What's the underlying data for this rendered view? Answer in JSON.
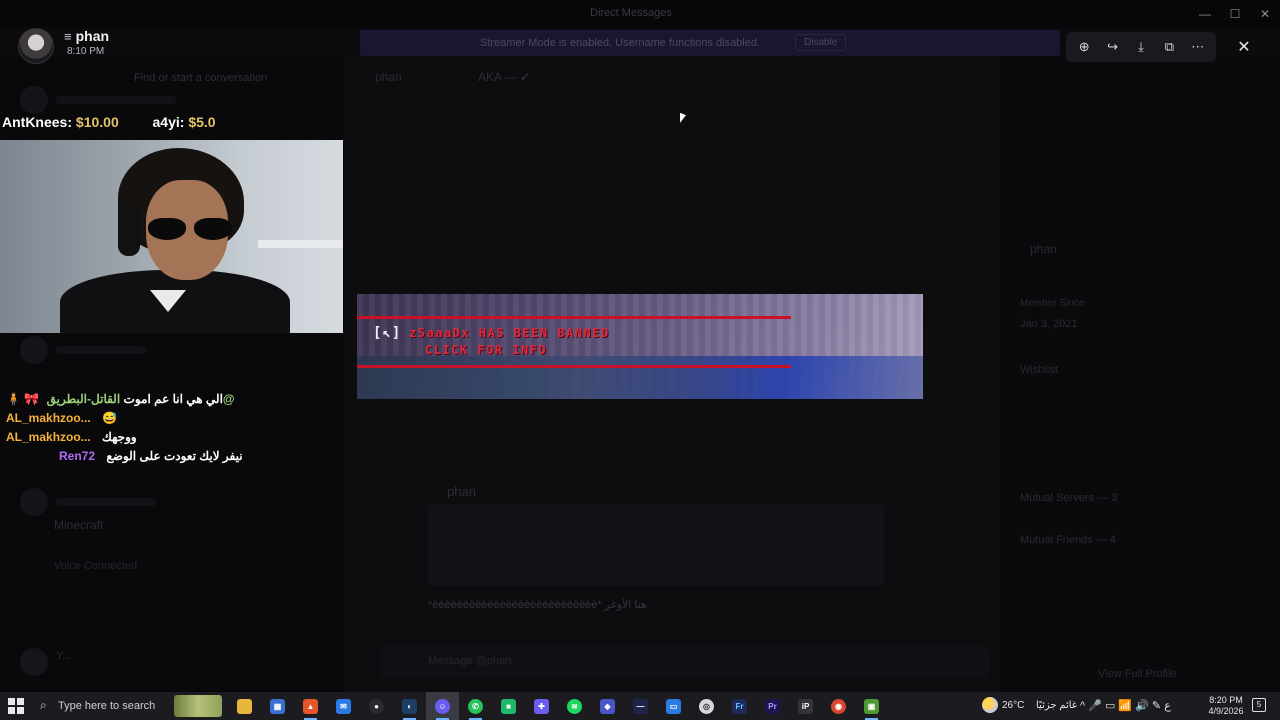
{
  "background_app": {
    "window_title": "Direct Messages",
    "notice": "Streamer Mode is enabled. Username functions disabled.",
    "notice_button": "Disable",
    "search_placeholder": "Find or start a conversation",
    "chat_header_name": "phan",
    "chat_header_extra": "AKA — ✔",
    "message_author": "phan",
    "message_text": "*ѐѐѐѐѐѐѐѐѐѐѐѐѐѐѐѐѐѐѐѐѐѐѐѐѐѐѐ* هنا الأوغر",
    "input_placeholder": "Message @phan",
    "voice_channel": "Minecraft",
    "voice_status": "Voice Connected",
    "self_name": "Y...",
    "profile_name": "phan",
    "member_since_label": "Member Since",
    "member_since_value": "Jan 3, 2021",
    "wishlist_label": "Wishlist",
    "mutual_servers": "Mutual Servers — 3",
    "mutual_friends": "Mutual Friends — 4",
    "view_full_profile": "View Full Profile"
  },
  "viewer": {
    "username": "phan",
    "username_icon": "bars-icon",
    "timestamp": "8:10 PM",
    "toolbar": [
      "zoom-in-icon",
      "forward-icon",
      "download-icon",
      "open-external-icon",
      "more-icon"
    ],
    "close_icon": "close-icon"
  },
  "stream_overlay": {
    "donations": [
      {
        "donor": "AntKnees:",
        "amount": "$10.00"
      },
      {
        "donor": "a4yi:",
        "amount": "$5.0"
      }
    ],
    "chat": [
      {
        "user": "القاتل-البطريق@",
        "user_color": "#9bd37a",
        "message": "الي هي انا عم اموت",
        "deco": "🎀"
      },
      {
        "user": "AL_makhzoo...",
        "user_color": "#f5b23a",
        "message": "😅"
      },
      {
        "user": "AL_makhzoo...",
        "user_color": "#f5b23a",
        "message": "ووجهك"
      },
      {
        "user": "Ren72",
        "user_color": "#b06cf0",
        "message": "نيفر لايك تعودت على الوضع"
      }
    ]
  },
  "media": {
    "bracket": "[↖]",
    "ban_line": "z5aaaDx HAS BEEN BANNED",
    "info_line": "CLICK FOR INFO",
    "accent": "#e0283d"
  },
  "taskbar": {
    "search_placeholder": "Type here to search",
    "temperature": "26°C",
    "weather_text": "غائم جزئيًا",
    "time": "8:20 PM",
    "date": "4/9/2026",
    "notification_count": "5"
  }
}
